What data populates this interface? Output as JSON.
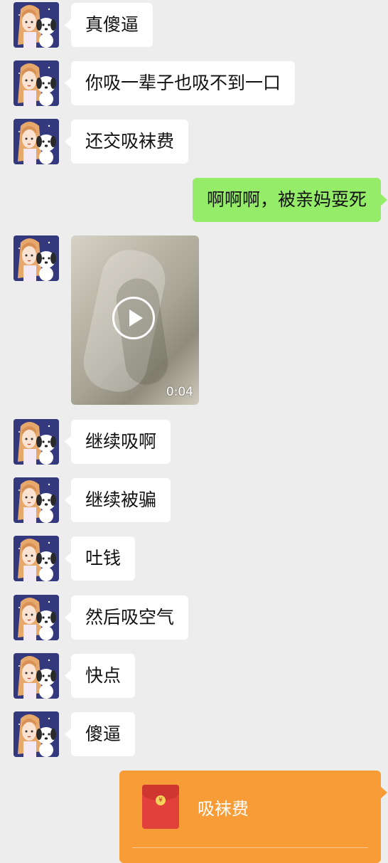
{
  "messages": [
    {
      "text": "真傻逼"
    },
    {
      "text": "你吸一辈子也吸不到一口"
    },
    {
      "text": "还交吸袜费"
    },
    {
      "text": "啊啊啊，被亲妈耍死"
    },
    {
      "video_duration": "0:04"
    },
    {
      "text": "继续吸啊"
    },
    {
      "text": "继续被骗"
    },
    {
      "text": "吐钱"
    },
    {
      "text": "然后吸空气"
    },
    {
      "text": "快点"
    },
    {
      "text": "傻逼"
    }
  ],
  "red_packet": {
    "label": "吸袜费",
    "coin_symbol": "¥",
    "color": "#f79c36"
  },
  "colors": {
    "background": "#ededed",
    "self_bubble": "#95ec69",
    "other_bubble": "#ffffff"
  }
}
